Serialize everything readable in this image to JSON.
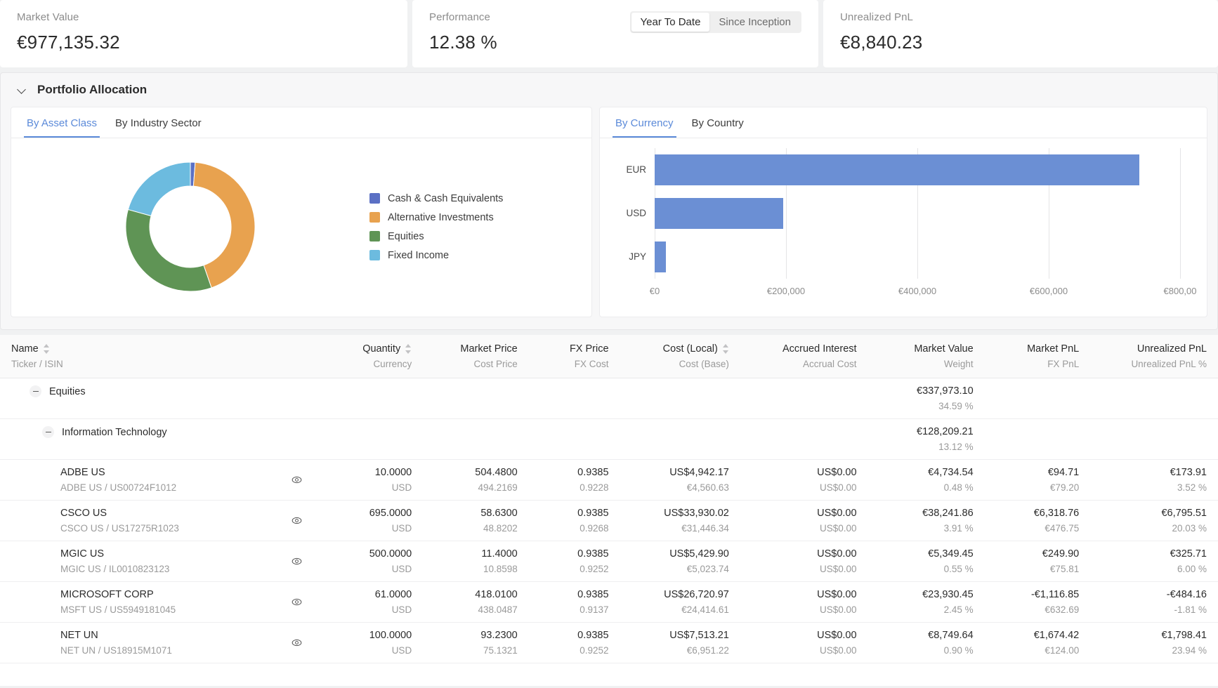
{
  "kpis": [
    {
      "label": "Market Value",
      "value": "€977,135.32"
    },
    {
      "label": "Performance",
      "value": "12.38 %"
    },
    {
      "label": "Unrealized PnL",
      "value": "€8,840.23"
    }
  ],
  "performance_toggle": {
    "options": [
      "Year To Date",
      "Since Inception"
    ],
    "selected": "Year To Date"
  },
  "allocation": {
    "title": "Portfolio Allocation",
    "left_tabs": [
      {
        "label": "By Asset Class",
        "active": true
      },
      {
        "label": "By Industry Sector",
        "active": false
      }
    ],
    "right_tabs": [
      {
        "label": "By Currency",
        "active": true
      },
      {
        "label": "By Country",
        "active": false
      }
    ]
  },
  "chart_data": [
    {
      "type": "pie",
      "title": "By Asset Class",
      "variant": "donut",
      "legend_position": "right",
      "labels": [
        "Cash & Cash Equivalents",
        "Alternative Investments",
        "Equities",
        "Fixed Income"
      ],
      "values": [
        1.2,
        43.5,
        34.6,
        20.7
      ],
      "colors": [
        "#5b70c4",
        "#e8a24f",
        "#5f9455",
        "#6cbbdf"
      ]
    },
    {
      "type": "bar",
      "title": "By Currency",
      "orientation": "horizontal",
      "categories": [
        "EUR",
        "USD",
        "JPY"
      ],
      "values": [
        738000,
        196000,
        17000
      ],
      "xlabel": "",
      "ylabel": "",
      "xlim": [
        0,
        800000
      ],
      "xticks": [
        0,
        200000,
        400000,
        600000,
        800000
      ],
      "xtick_labels": [
        "€0",
        "€200,000",
        "€400,000",
        "€600,000",
        "€800,00"
      ],
      "grid": true,
      "bar_color": "#6b8fd4"
    }
  ],
  "table": {
    "columns": [
      {
        "main": "Name",
        "sub": "Ticker / ISIN",
        "align": "lft",
        "sortable": true
      },
      {
        "main": "Quantity",
        "sub": "Currency",
        "align": "num",
        "sortable": true
      },
      {
        "main": "Market Price",
        "sub": "Cost Price",
        "align": "num",
        "sortable": false
      },
      {
        "main": "FX Price",
        "sub": "FX Cost",
        "align": "num",
        "sortable": false
      },
      {
        "main": "Cost (Local)",
        "sub": "Cost (Base)",
        "align": "num",
        "sortable": true
      },
      {
        "main": "Accrued Interest",
        "sub": "Accrual Cost",
        "align": "num",
        "sortable": false
      },
      {
        "main": "Market Value",
        "sub": "Weight",
        "align": "num",
        "sortable": false
      },
      {
        "main": "Market PnL",
        "sub": "FX PnL",
        "align": "num",
        "sortable": false
      },
      {
        "main": "Unrealized PnL",
        "sub": "Unrealized PnL %",
        "align": "num",
        "sortable": false
      }
    ],
    "rows": [
      {
        "kind": "group",
        "level": 1,
        "expanded": true,
        "name": "Equities",
        "ticker": "",
        "quantity": "",
        "currency": "",
        "market_price": "",
        "cost_price": "",
        "fx_price": "",
        "fx_cost": "",
        "cost_local": "",
        "cost_base": "",
        "accrued_interest": "",
        "accrual_cost": "",
        "market_value": "€337,973.10",
        "weight": "34.59 %",
        "market_pnl": "",
        "fx_pnl": "",
        "unrealized_pnl": "",
        "unrealized_pnl_pct": ""
      },
      {
        "kind": "group",
        "level": 2,
        "expanded": true,
        "name": "Information Technology",
        "ticker": "",
        "quantity": "",
        "currency": "",
        "market_price": "",
        "cost_price": "",
        "fx_price": "",
        "fx_cost": "",
        "cost_local": "",
        "cost_base": "",
        "accrued_interest": "",
        "accrual_cost": "",
        "market_value": "€128,209.21",
        "weight": "13.12 %",
        "market_pnl": "",
        "fx_pnl": "",
        "unrealized_pnl": "",
        "unrealized_pnl_pct": ""
      },
      {
        "kind": "item",
        "level": 3,
        "name": "ADBE US",
        "ticker": "ADBE US / US00724F1012",
        "quantity": "10.0000",
        "currency": "USD",
        "market_price": "504.4800",
        "cost_price": "494.2169",
        "fx_price": "0.9385",
        "fx_cost": "0.9228",
        "cost_local": "US$4,942.17",
        "cost_base": "€4,560.63",
        "accrued_interest": "US$0.00",
        "accrual_cost": "US$0.00",
        "market_value": "€4,734.54",
        "weight": "0.48 %",
        "market_pnl": "€94.71",
        "fx_pnl": "€79.20",
        "unrealized_pnl": "€173.91",
        "unrealized_pnl_pct": "3.52 %"
      },
      {
        "kind": "item",
        "level": 3,
        "name": "CSCO US",
        "ticker": "CSCO US / US17275R1023",
        "quantity": "695.0000",
        "currency": "USD",
        "market_price": "58.6300",
        "cost_price": "48.8202",
        "fx_price": "0.9385",
        "fx_cost": "0.9268",
        "cost_local": "US$33,930.02",
        "cost_base": "€31,446.34",
        "accrued_interest": "US$0.00",
        "accrual_cost": "US$0.00",
        "market_value": "€38,241.86",
        "weight": "3.91 %",
        "market_pnl": "€6,318.76",
        "fx_pnl": "€476.75",
        "unrealized_pnl": "€6,795.51",
        "unrealized_pnl_pct": "20.03 %"
      },
      {
        "kind": "item",
        "level": 3,
        "name": "MGIC US",
        "ticker": "MGIC US / IL0010823123",
        "quantity": "500.0000",
        "currency": "USD",
        "market_price": "11.4000",
        "cost_price": "10.8598",
        "fx_price": "0.9385",
        "fx_cost": "0.9252",
        "cost_local": "US$5,429.90",
        "cost_base": "€5,023.74",
        "accrued_interest": "US$0.00",
        "accrual_cost": "US$0.00",
        "market_value": "€5,349.45",
        "weight": "0.55 %",
        "market_pnl": "€249.90",
        "fx_pnl": "€75.81",
        "unrealized_pnl": "€325.71",
        "unrealized_pnl_pct": "6.00 %"
      },
      {
        "kind": "item",
        "level": 3,
        "name": "MICROSOFT CORP",
        "ticker": "MSFT US / US5949181045",
        "quantity": "61.0000",
        "currency": "USD",
        "market_price": "418.0100",
        "cost_price": "438.0487",
        "fx_price": "0.9385",
        "fx_cost": "0.9137",
        "cost_local": "US$26,720.97",
        "cost_base": "€24,414.61",
        "accrued_interest": "US$0.00",
        "accrual_cost": "US$0.00",
        "market_value": "€23,930.45",
        "weight": "2.45 %",
        "market_pnl": "-€1,116.85",
        "fx_pnl": "€632.69",
        "unrealized_pnl": "-€484.16",
        "unrealized_pnl_pct": "-1.81 %"
      },
      {
        "kind": "item",
        "level": 3,
        "name": "NET UN",
        "ticker": "NET UN / US18915M1071",
        "quantity": "100.0000",
        "currency": "USD",
        "market_price": "93.2300",
        "cost_price": "75.1321",
        "fx_price": "0.9385",
        "fx_cost": "0.9252",
        "cost_local": "US$7,513.21",
        "cost_base": "€6,951.22",
        "accrued_interest": "US$0.00",
        "accrual_cost": "US$0.00",
        "market_value": "€8,749.64",
        "weight": "0.90 %",
        "market_pnl": "€1,674.42",
        "fx_pnl": "€124.00",
        "unrealized_pnl": "€1,798.41",
        "unrealized_pnl_pct": "23.94 %"
      }
    ]
  }
}
